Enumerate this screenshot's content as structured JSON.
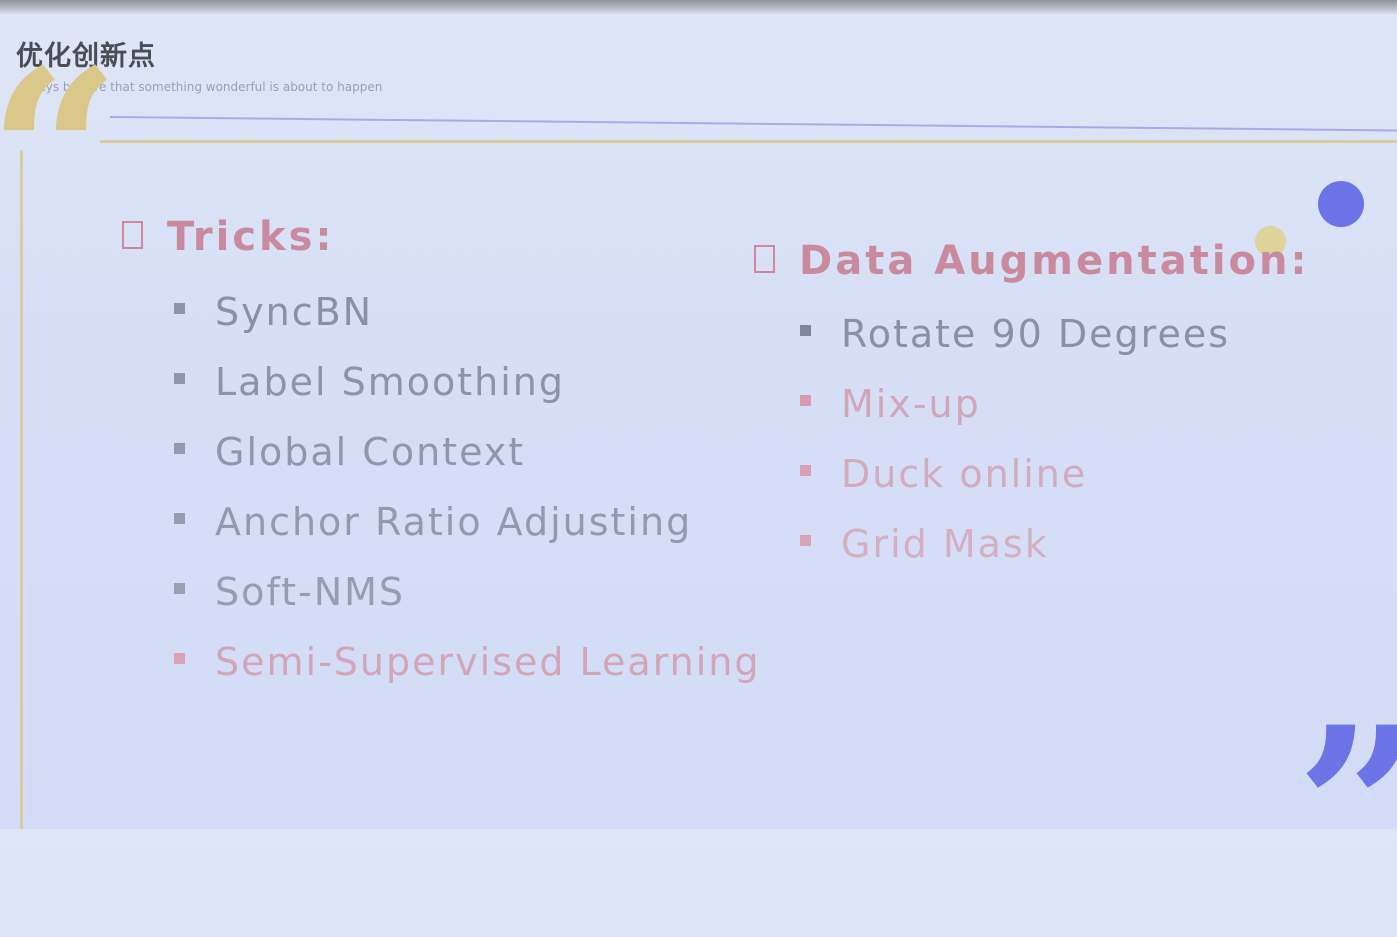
{
  "header": {
    "title": "优化创新点",
    "subtitle": "Always believe that something wonderful is about to happen"
  },
  "decor": {
    "open_quote": "“",
    "close_quote": "”",
    "gold": "#d9c88a",
    "blue": "#6b73e6"
  },
  "tricks": {
    "heading": "Tricks:",
    "items": [
      {
        "label": "SyncBN",
        "color": "#8a90a5",
        "bullet": "#8f94a8"
      },
      {
        "label": "Label Smoothing",
        "color": "#8d93a8",
        "bullet": "#9096ab"
      },
      {
        "label": "Global Context",
        "color": "#9096ab",
        "bullet": "#9499ad"
      },
      {
        "label": "Anchor Ratio Adjusting",
        "color": "#9499ae",
        "bullet": "#979caf"
      },
      {
        "label": "Soft-NMS",
        "color": "#979cb1",
        "bullet": "#9a9fb2"
      },
      {
        "label": "Semi-Supervised Learning",
        "color": "#d2a6b8",
        "bullet": "#d9a2b6"
      }
    ]
  },
  "augmentation": {
    "heading": "Data Augmentation:",
    "items": [
      {
        "label": "Rotate 90 Degrees",
        "color": "#8a90a5",
        "bullet": "#7f86a0"
      },
      {
        "label": "Mix-up",
        "color": "#cfa7b9",
        "bullet": "#d89aae"
      },
      {
        "label": "Duck online",
        "color": "#d2abbd",
        "bullet": "#d9a0b4"
      },
      {
        "label": "Grid Mask",
        "color": "#d3afbf",
        "bullet": "#daa4b7"
      }
    ]
  }
}
